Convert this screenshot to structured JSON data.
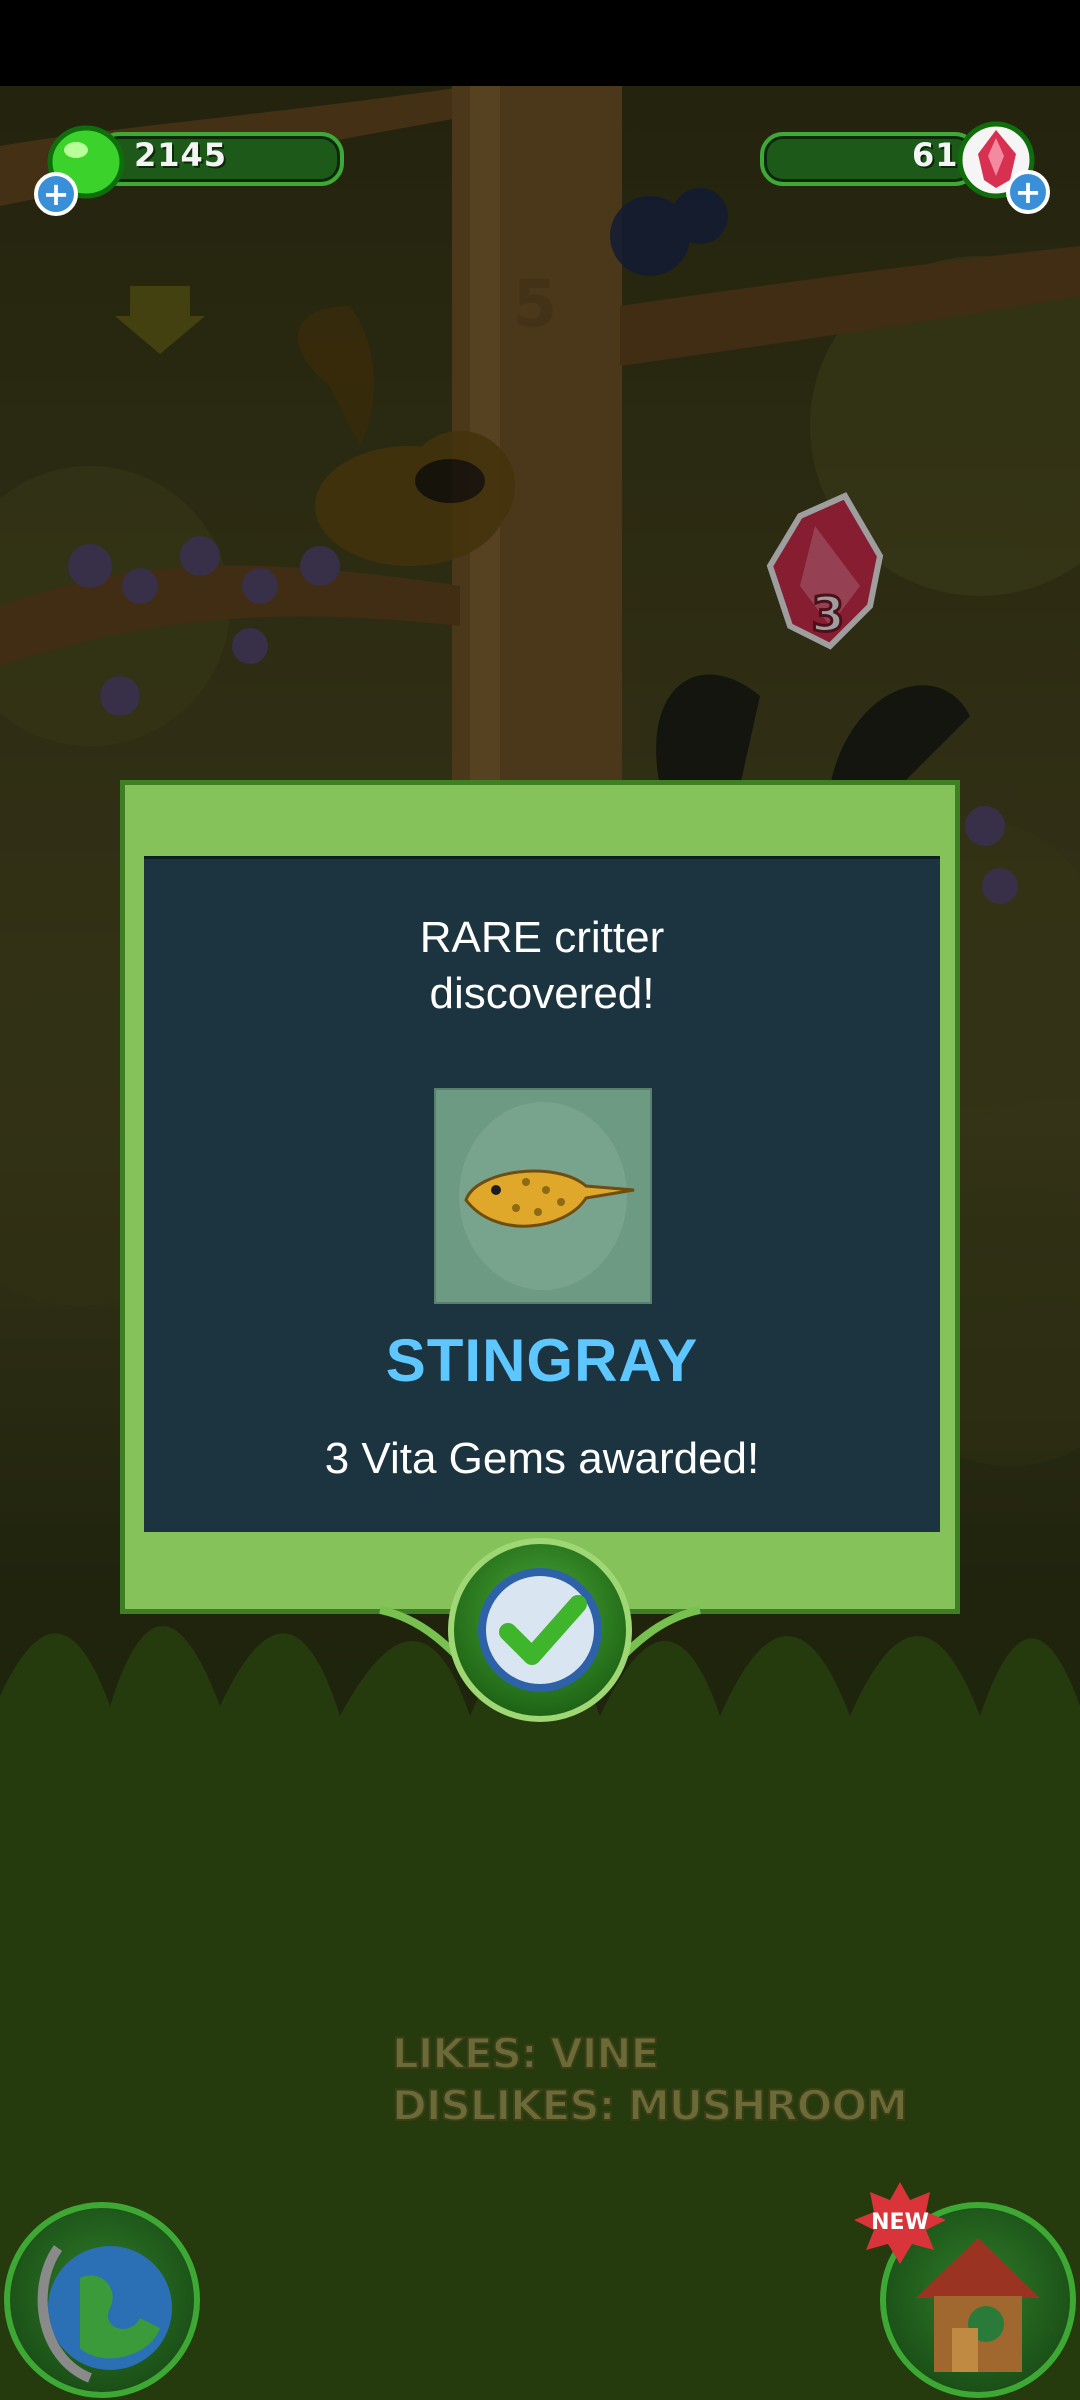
{
  "hud": {
    "left_currency": {
      "value": "2145",
      "icon": "green-gem-icon"
    },
    "right_currency": {
      "value": "61",
      "icon": "red-crystal-icon"
    },
    "add_label": "+"
  },
  "scene": {
    "tree_marker": "5",
    "floating_reward_count": "3",
    "likes_line": "LIKES: VINE",
    "dislikes_line": "DISLIKES: MUSHROOM",
    "new_badge": "NEW"
  },
  "dialog": {
    "title": "RARE critter\ndiscovered!",
    "critter_name": "STINGRAY",
    "award_text": "3 Vita Gems awarded!",
    "critter_icon": "stingray-icon"
  },
  "colors": {
    "panel_green": "#86c25a",
    "panel_dark": "#1b3440",
    "critter_name": "#5fc7ff"
  }
}
